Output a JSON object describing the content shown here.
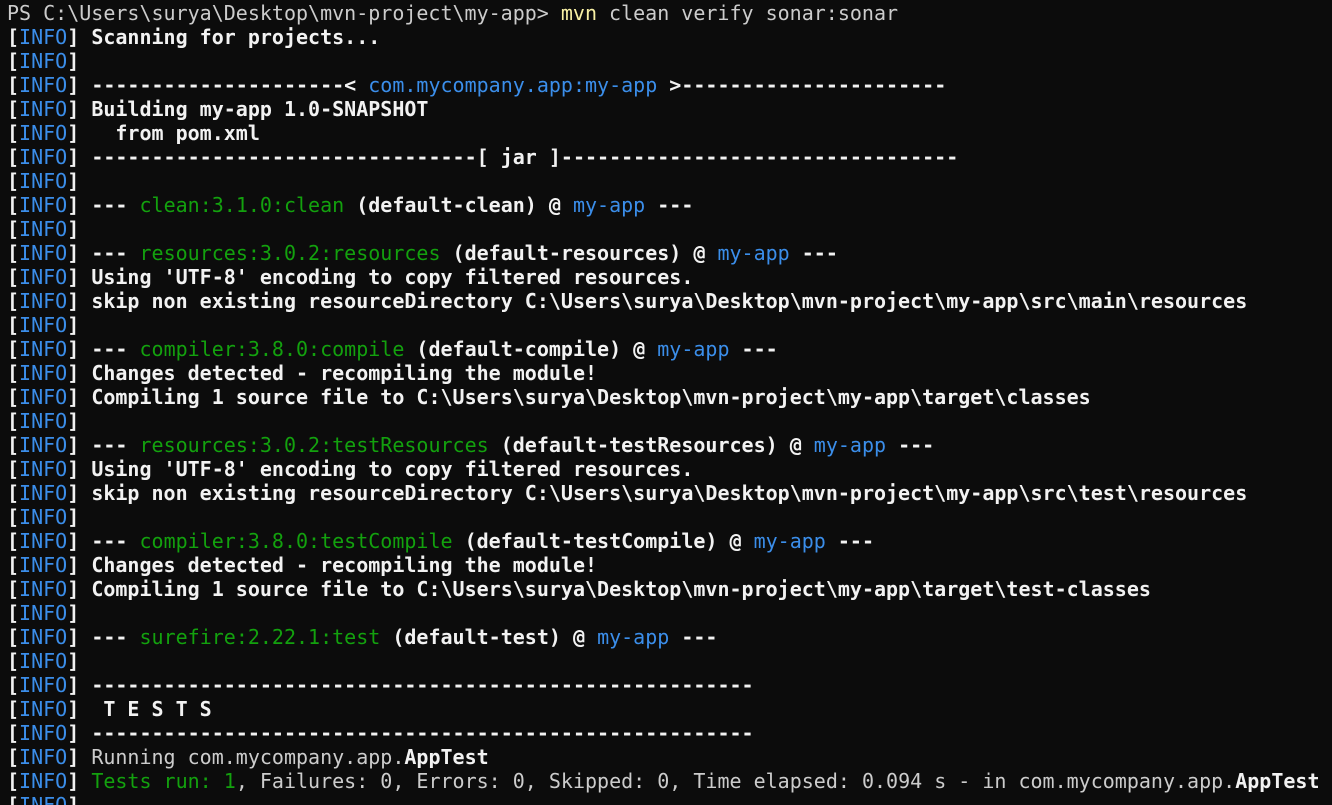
{
  "colors": {
    "background": "#0c0c0c",
    "default": "#cccccc",
    "blue": "#3b8eea",
    "green": "#13a10e",
    "yellow": "#f9f1a5",
    "bold": "#f2f2f2"
  },
  "terminal": {
    "lines": [
      {
        "segments": [
          {
            "t": "PS C:\\Users\\surya\\Desktop\\mvn-project\\my-app> ",
            "c": "default"
          },
          {
            "t": "mvn",
            "c": "yellow"
          },
          {
            "t": " clean verify sonar:sonar",
            "c": "default"
          }
        ]
      },
      {
        "segments": [
          {
            "t": "[",
            "c": "bold"
          },
          {
            "t": "INFO",
            "c": "blue"
          },
          {
            "t": "] ",
            "c": "bold"
          },
          {
            "t": "Scanning for projects...",
            "c": "bold"
          }
        ]
      },
      {
        "segments": [
          {
            "t": "[",
            "c": "bold"
          },
          {
            "t": "INFO",
            "c": "blue"
          },
          {
            "t": "]",
            "c": "bold"
          }
        ]
      },
      {
        "segments": [
          {
            "t": "[",
            "c": "bold"
          },
          {
            "t": "INFO",
            "c": "blue"
          },
          {
            "t": "] ",
            "c": "bold"
          },
          {
            "t": "---------------------< ",
            "c": "bold"
          },
          {
            "t": "com.mycompany.app:my-app",
            "c": "blue"
          },
          {
            "t": " >----------------------",
            "c": "bold"
          }
        ]
      },
      {
        "segments": [
          {
            "t": "[",
            "c": "bold"
          },
          {
            "t": "INFO",
            "c": "blue"
          },
          {
            "t": "] ",
            "c": "bold"
          },
          {
            "t": "Building my-app 1.0-SNAPSHOT",
            "c": "bold"
          }
        ]
      },
      {
        "segments": [
          {
            "t": "[",
            "c": "bold"
          },
          {
            "t": "INFO",
            "c": "blue"
          },
          {
            "t": "] ",
            "c": "bold"
          },
          {
            "t": "  from pom.xml",
            "c": "bold"
          }
        ]
      },
      {
        "segments": [
          {
            "t": "[",
            "c": "bold"
          },
          {
            "t": "INFO",
            "c": "blue"
          },
          {
            "t": "] ",
            "c": "bold"
          },
          {
            "t": "--------------------------------[ jar ]---------------------------------",
            "c": "bold"
          }
        ]
      },
      {
        "segments": [
          {
            "t": "[",
            "c": "bold"
          },
          {
            "t": "INFO",
            "c": "blue"
          },
          {
            "t": "]",
            "c": "bold"
          }
        ]
      },
      {
        "segments": [
          {
            "t": "[",
            "c": "bold"
          },
          {
            "t": "INFO",
            "c": "blue"
          },
          {
            "t": "] ",
            "c": "bold"
          },
          {
            "t": "--- ",
            "c": "bold"
          },
          {
            "t": "clean:3.1.0:clean",
            "c": "green"
          },
          {
            "t": " (default-clean) @ ",
            "c": "bold"
          },
          {
            "t": "my-app",
            "c": "blue"
          },
          {
            "t": " ---",
            "c": "bold"
          }
        ]
      },
      {
        "segments": [
          {
            "t": "[",
            "c": "bold"
          },
          {
            "t": "INFO",
            "c": "blue"
          },
          {
            "t": "]",
            "c": "bold"
          }
        ]
      },
      {
        "segments": [
          {
            "t": "[",
            "c": "bold"
          },
          {
            "t": "INFO",
            "c": "blue"
          },
          {
            "t": "] ",
            "c": "bold"
          },
          {
            "t": "--- ",
            "c": "bold"
          },
          {
            "t": "resources:3.0.2:resources",
            "c": "green"
          },
          {
            "t": " (default-resources) @ ",
            "c": "bold"
          },
          {
            "t": "my-app",
            "c": "blue"
          },
          {
            "t": " ---",
            "c": "bold"
          }
        ]
      },
      {
        "segments": [
          {
            "t": "[",
            "c": "bold"
          },
          {
            "t": "INFO",
            "c": "blue"
          },
          {
            "t": "] ",
            "c": "bold"
          },
          {
            "t": "Using 'UTF-8' encoding to copy filtered resources.",
            "c": "bold"
          }
        ]
      },
      {
        "segments": [
          {
            "t": "[",
            "c": "bold"
          },
          {
            "t": "INFO",
            "c": "blue"
          },
          {
            "t": "] ",
            "c": "bold"
          },
          {
            "t": "skip non existing resourceDirectory C:\\Users\\surya\\Desktop\\mvn-project\\my-app\\src\\main\\resources",
            "c": "bold"
          }
        ]
      },
      {
        "segments": [
          {
            "t": "[",
            "c": "bold"
          },
          {
            "t": "INFO",
            "c": "blue"
          },
          {
            "t": "]",
            "c": "bold"
          }
        ]
      },
      {
        "segments": [
          {
            "t": "[",
            "c": "bold"
          },
          {
            "t": "INFO",
            "c": "blue"
          },
          {
            "t": "] ",
            "c": "bold"
          },
          {
            "t": "--- ",
            "c": "bold"
          },
          {
            "t": "compiler:3.8.0:compile",
            "c": "green"
          },
          {
            "t": " (default-compile) @ ",
            "c": "bold"
          },
          {
            "t": "my-app",
            "c": "blue"
          },
          {
            "t": " ---",
            "c": "bold"
          }
        ]
      },
      {
        "segments": [
          {
            "t": "[",
            "c": "bold"
          },
          {
            "t": "INFO",
            "c": "blue"
          },
          {
            "t": "] ",
            "c": "bold"
          },
          {
            "t": "Changes detected - recompiling the module!",
            "c": "bold"
          }
        ]
      },
      {
        "segments": [
          {
            "t": "[",
            "c": "bold"
          },
          {
            "t": "INFO",
            "c": "blue"
          },
          {
            "t": "] ",
            "c": "bold"
          },
          {
            "t": "Compiling 1 source file to C:\\Users\\surya\\Desktop\\mvn-project\\my-app\\target\\classes",
            "c": "bold"
          }
        ]
      },
      {
        "segments": [
          {
            "t": "[",
            "c": "bold"
          },
          {
            "t": "INFO",
            "c": "blue"
          },
          {
            "t": "]",
            "c": "bold"
          }
        ]
      },
      {
        "segments": [
          {
            "t": "[",
            "c": "bold"
          },
          {
            "t": "INFO",
            "c": "blue"
          },
          {
            "t": "] ",
            "c": "bold"
          },
          {
            "t": "--- ",
            "c": "bold"
          },
          {
            "t": "resources:3.0.2:testResources",
            "c": "green"
          },
          {
            "t": " (default-testResources) @ ",
            "c": "bold"
          },
          {
            "t": "my-app",
            "c": "blue"
          },
          {
            "t": " ---",
            "c": "bold"
          }
        ]
      },
      {
        "segments": [
          {
            "t": "[",
            "c": "bold"
          },
          {
            "t": "INFO",
            "c": "blue"
          },
          {
            "t": "] ",
            "c": "bold"
          },
          {
            "t": "Using 'UTF-8' encoding to copy filtered resources.",
            "c": "bold"
          }
        ]
      },
      {
        "segments": [
          {
            "t": "[",
            "c": "bold"
          },
          {
            "t": "INFO",
            "c": "blue"
          },
          {
            "t": "] ",
            "c": "bold"
          },
          {
            "t": "skip non existing resourceDirectory C:\\Users\\surya\\Desktop\\mvn-project\\my-app\\src\\test\\resources",
            "c": "bold"
          }
        ]
      },
      {
        "segments": [
          {
            "t": "[",
            "c": "bold"
          },
          {
            "t": "INFO",
            "c": "blue"
          },
          {
            "t": "]",
            "c": "bold"
          }
        ]
      },
      {
        "segments": [
          {
            "t": "[",
            "c": "bold"
          },
          {
            "t": "INFO",
            "c": "blue"
          },
          {
            "t": "] ",
            "c": "bold"
          },
          {
            "t": "--- ",
            "c": "bold"
          },
          {
            "t": "compiler:3.8.0:testCompile",
            "c": "green"
          },
          {
            "t": " (default-testCompile) @ ",
            "c": "bold"
          },
          {
            "t": "my-app",
            "c": "blue"
          },
          {
            "t": " ---",
            "c": "bold"
          }
        ]
      },
      {
        "segments": [
          {
            "t": "[",
            "c": "bold"
          },
          {
            "t": "INFO",
            "c": "blue"
          },
          {
            "t": "] ",
            "c": "bold"
          },
          {
            "t": "Changes detected - recompiling the module!",
            "c": "bold"
          }
        ]
      },
      {
        "segments": [
          {
            "t": "[",
            "c": "bold"
          },
          {
            "t": "INFO",
            "c": "blue"
          },
          {
            "t": "] ",
            "c": "bold"
          },
          {
            "t": "Compiling 1 source file to C:\\Users\\surya\\Desktop\\mvn-project\\my-app\\target\\test-classes",
            "c": "bold"
          }
        ]
      },
      {
        "segments": [
          {
            "t": "[",
            "c": "bold"
          },
          {
            "t": "INFO",
            "c": "blue"
          },
          {
            "t": "]",
            "c": "bold"
          }
        ]
      },
      {
        "segments": [
          {
            "t": "[",
            "c": "bold"
          },
          {
            "t": "INFO",
            "c": "blue"
          },
          {
            "t": "] ",
            "c": "bold"
          },
          {
            "t": "--- ",
            "c": "bold"
          },
          {
            "t": "surefire:2.22.1:test",
            "c": "green"
          },
          {
            "t": " (default-test) @ ",
            "c": "bold"
          },
          {
            "t": "my-app",
            "c": "blue"
          },
          {
            "t": " ---",
            "c": "bold"
          }
        ]
      },
      {
        "segments": [
          {
            "t": "[",
            "c": "bold"
          },
          {
            "t": "INFO",
            "c": "blue"
          },
          {
            "t": "]",
            "c": "bold"
          }
        ]
      },
      {
        "segments": [
          {
            "t": "[",
            "c": "bold"
          },
          {
            "t": "INFO",
            "c": "blue"
          },
          {
            "t": "] ",
            "c": "bold"
          },
          {
            "t": "-------------------------------------------------------",
            "c": "bold"
          }
        ]
      },
      {
        "segments": [
          {
            "t": "[",
            "c": "bold"
          },
          {
            "t": "INFO",
            "c": "blue"
          },
          {
            "t": "] ",
            "c": "bold"
          },
          {
            "t": " T E S T S",
            "c": "bold"
          }
        ]
      },
      {
        "segments": [
          {
            "t": "[",
            "c": "bold"
          },
          {
            "t": "INFO",
            "c": "blue"
          },
          {
            "t": "] ",
            "c": "bold"
          },
          {
            "t": "-------------------------------------------------------",
            "c": "bold"
          }
        ]
      },
      {
        "segments": [
          {
            "t": "[",
            "c": "bold"
          },
          {
            "t": "INFO",
            "c": "blue"
          },
          {
            "t": "] ",
            "c": "bold"
          },
          {
            "t": "Running com.mycompany.app.",
            "c": "default"
          },
          {
            "t": "AppTest",
            "c": "bold"
          }
        ]
      },
      {
        "segments": [
          {
            "t": "[",
            "c": "bold"
          },
          {
            "t": "INFO",
            "c": "blue"
          },
          {
            "t": "] ",
            "c": "bold"
          },
          {
            "t": "Tests run: 1",
            "c": "green"
          },
          {
            "t": ", Failures: 0, Errors: 0, Skipped: 0, Time elapsed: 0.094 s - in com.mycompany.app.",
            "c": "default"
          },
          {
            "t": "AppTest",
            "c": "bold"
          }
        ]
      },
      {
        "segments": [
          {
            "t": "[",
            "c": "bold"
          },
          {
            "t": "INFO",
            "c": "blue"
          },
          {
            "t": "]",
            "c": "bold"
          }
        ]
      }
    ]
  }
}
